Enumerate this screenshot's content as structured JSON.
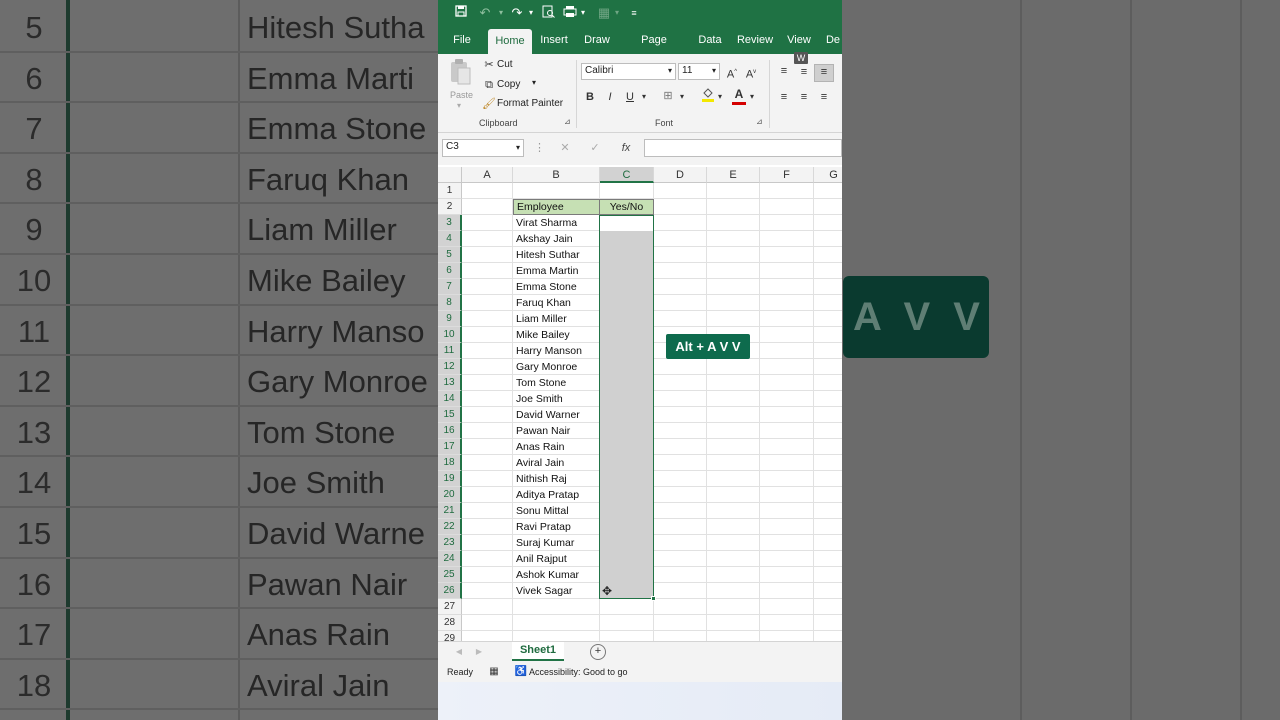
{
  "colors": {
    "excel_green": "#1f7244",
    "header_fill": "#c6e0b4",
    "selection_fill": "#d0d0d0",
    "hint_bg": "#0e6b4d"
  },
  "background": {
    "row_numbers": [
      "5",
      "6",
      "7",
      "8",
      "9",
      "10",
      "11",
      "12",
      "13",
      "14",
      "15",
      "16",
      "17",
      "18"
    ],
    "names": [
      "Hitesh Sutha",
      "Emma Marti",
      "Emma Stone",
      "Faruq Khan",
      "Liam Miller",
      "Mike Bailey",
      "Harry Manso",
      "Gary Monroe",
      "Tom Stone",
      "Joe Smith",
      "David Warne",
      "Pawan Nair",
      "Anas Rain",
      "Aviral Jain"
    ],
    "badge_text": "A V V"
  },
  "qat": {
    "icons": [
      "save-icon",
      "undo-icon",
      "redo-icon",
      "print-preview-icon",
      "print-icon",
      "form-icon",
      "customize-icon"
    ]
  },
  "ribbon": {
    "tabs": [
      "File",
      "Home",
      "Insert",
      "Draw",
      "Page Layout",
      "Data",
      "Review",
      "View",
      "De"
    ],
    "active_tab": "Home",
    "clipboard": {
      "paste": "Paste",
      "cut": "Cut",
      "copy": "Copy",
      "format_painter": "Format Painter",
      "group": "Clipboard"
    },
    "font": {
      "name": "Calibri",
      "size": "11",
      "bold": "B",
      "italic": "I",
      "underline": "U",
      "grow": "A",
      "shrink": "A",
      "font_color": "A",
      "group": "Font"
    },
    "keytip": "W"
  },
  "formula_bar": {
    "name_box": "C3",
    "fx": "fx",
    "value": ""
  },
  "sheet": {
    "columns": [
      "A",
      "B",
      "C",
      "D",
      "E",
      "F",
      "G"
    ],
    "rows": [
      "1",
      "2",
      "3",
      "4",
      "5",
      "6",
      "7",
      "8",
      "9",
      "10",
      "11",
      "12",
      "13",
      "14",
      "15",
      "16",
      "17",
      "18",
      "19",
      "20",
      "21",
      "22",
      "23",
      "24",
      "25",
      "26",
      "27",
      "28",
      "29"
    ],
    "headers": {
      "employee": "Employee",
      "yes_no": "Yes/No"
    },
    "employees": [
      "Virat Sharma",
      "Akshay Jain",
      "Hitesh Suthar",
      "Emma Martin",
      "Emma Stone",
      "Faruq Khan",
      "Liam Miller",
      "Mike Bailey",
      "Harry Manson",
      "Gary Monroe",
      "Tom Stone",
      "Joe Smith",
      "David Warner",
      "Pawan Nair",
      "Anas Rain",
      "Aviral Jain",
      "Nithish Raj",
      "Aditya Pratap",
      "Sonu Mittal",
      "Ravi Pratap",
      "Suraj Kumar",
      "Anil Rajput",
      "Ashok Kumar",
      "Vivek Sagar"
    ]
  },
  "shortcut_hint": "Alt + A V V",
  "sheet_tab": "Sheet1",
  "status": {
    "ready": "Ready",
    "accessibility": "Accessibility: Good to go"
  }
}
